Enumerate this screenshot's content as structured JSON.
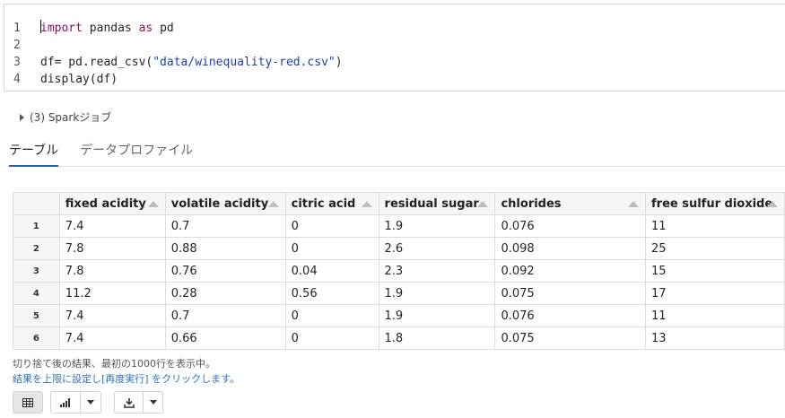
{
  "code": {
    "line_numbers": [
      "1",
      "2",
      "3",
      "4"
    ],
    "line1": {
      "kw1": "import",
      "mid": " pandas ",
      "kw2": "as",
      "tail": " pd"
    },
    "line3": {
      "prefix": "df= pd.read_csv(",
      "str": "\"data/winequality-red.csv\"",
      "suffix": ")"
    },
    "line4": "display(df)"
  },
  "spark_jobs": "(3) Sparkジョブ",
  "tabs": [
    {
      "label": "テーブル",
      "active": true
    },
    {
      "label": "データプロファイル",
      "active": false
    }
  ],
  "table": {
    "columns": [
      "fixed acidity",
      "volatile acidity",
      "citric acid",
      "residual sugar",
      "chlorides",
      "free sulfur dioxide"
    ],
    "rows": [
      {
        "index": "1",
        "cells": [
          "7.4",
          "0.7",
          "0",
          "1.9",
          "0.076",
          "11"
        ]
      },
      {
        "index": "2",
        "cells": [
          "7.8",
          "0.88",
          "0",
          "2.6",
          "0.098",
          "25"
        ]
      },
      {
        "index": "3",
        "cells": [
          "7.8",
          "0.76",
          "0.04",
          "2.3",
          "0.092",
          "15"
        ]
      },
      {
        "index": "4",
        "cells": [
          "11.2",
          "0.28",
          "0.56",
          "1.9",
          "0.075",
          "17"
        ]
      },
      {
        "index": "5",
        "cells": [
          "7.4",
          "0.7",
          "0",
          "1.9",
          "0.076",
          "11"
        ]
      },
      {
        "index": "6",
        "cells": [
          "7.4",
          "0.66",
          "0",
          "1.8",
          "0.075",
          "13"
        ]
      }
    ]
  },
  "truncation_note": "切り捨て後の結果、最初の1000行を表示中。",
  "rerun_link": "結果を上限に設定し[再度実行] をクリックします。",
  "toolbar": {
    "table_view_icon": "table-icon",
    "chart_icon": "bar-chart-icon",
    "download_icon": "download-icon"
  },
  "colors": {
    "keyword": "#8e0e5e",
    "string": "#1a3fb2",
    "tab_accent": "#2b5fab",
    "link": "#2b71c4"
  }
}
